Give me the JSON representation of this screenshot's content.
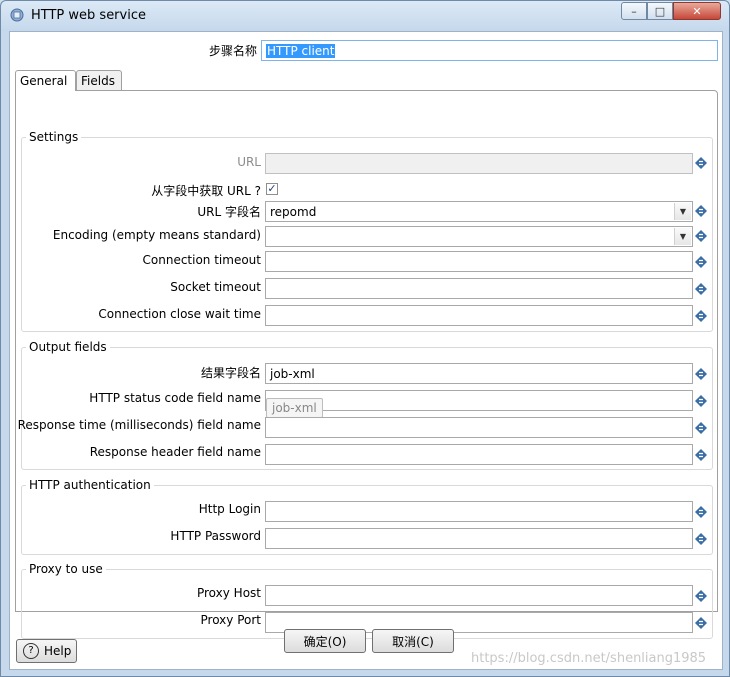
{
  "window": {
    "title": "HTTP web service",
    "minimize": "–",
    "maximize": "□",
    "close": "✕"
  },
  "step": {
    "label": "步骤名称",
    "value": "HTTP client"
  },
  "tabs": [
    {
      "label": "General"
    },
    {
      "label": "Fields"
    }
  ],
  "settings": {
    "title": "Settings",
    "url": {
      "label": "URL",
      "value": ""
    },
    "url_from_field": {
      "label": "从字段中获取 URL ?",
      "checked": true,
      "check_mark": "✓"
    },
    "url_field_name": {
      "label": "URL 字段名",
      "value": "repomd"
    },
    "encoding": {
      "label": "Encoding (empty means standard)",
      "value": ""
    },
    "connection_timeout": {
      "label": "Connection timeout",
      "value": ""
    },
    "socket_timeout": {
      "label": "Socket timeout",
      "value": ""
    },
    "close_wait": {
      "label": "Connection close wait time",
      "value": ""
    }
  },
  "output": {
    "title": "Output fields",
    "result_field": {
      "label": "结果字段名",
      "value": "job-xml"
    },
    "status_code": {
      "label": "HTTP status code field name",
      "value": ""
    },
    "response_time": {
      "label": "Response time (milliseconds) field name",
      "value": ""
    },
    "response_header": {
      "label": "Response header field name",
      "value": ""
    },
    "tooltip": "job-xml"
  },
  "auth": {
    "title": "HTTP authentication",
    "login": {
      "label": "Http Login",
      "value": ""
    },
    "password": {
      "label": "HTTP Password",
      "value": ""
    }
  },
  "proxy": {
    "title": "Proxy to use",
    "host": {
      "label": "Proxy Host",
      "value": ""
    },
    "port": {
      "label": "Proxy Port",
      "value": ""
    }
  },
  "buttons": {
    "ok": "确定(O)",
    "cancel": "取消(C)",
    "help": "Help",
    "help_icon": "?"
  },
  "watermark": "https://blog.csdn.net/shenliang1985",
  "colors": {
    "accent": "#3399ff",
    "variable_icon": "#3a6ea5"
  }
}
